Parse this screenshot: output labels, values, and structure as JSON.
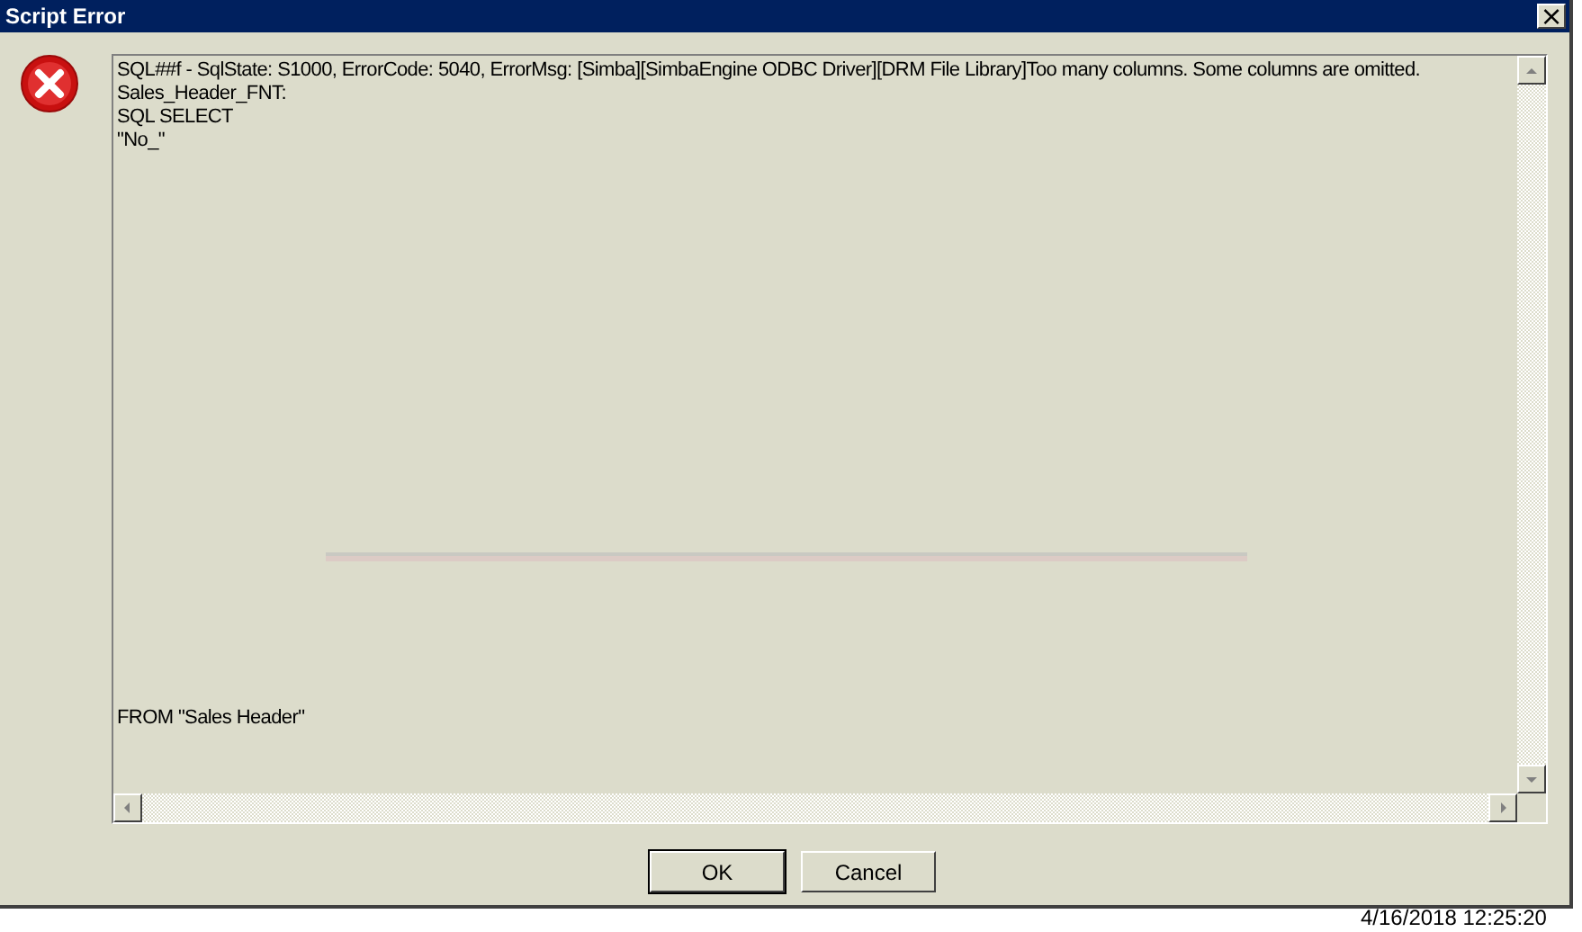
{
  "window": {
    "title": "Script Error",
    "close_glyph": "×"
  },
  "message": {
    "lines": [
      "SQL##f - SqlState: S1000, ErrorCode: 5040, ErrorMsg: [Simba][SimbaEngine ODBC Driver][DRM File Library]Too many columns. Some columns are omitted.",
      "Sales_Header_FNT:",
      "SQL SELECT",
      "\"No_\""
    ],
    "trailing_lines": [
      "FROM \"Sales Header\""
    ]
  },
  "buttons": [
    {
      "label": "OK",
      "default": true
    },
    {
      "label": "Cancel",
      "default": false
    }
  ],
  "background_text": "4/16/2018 12:25:20"
}
